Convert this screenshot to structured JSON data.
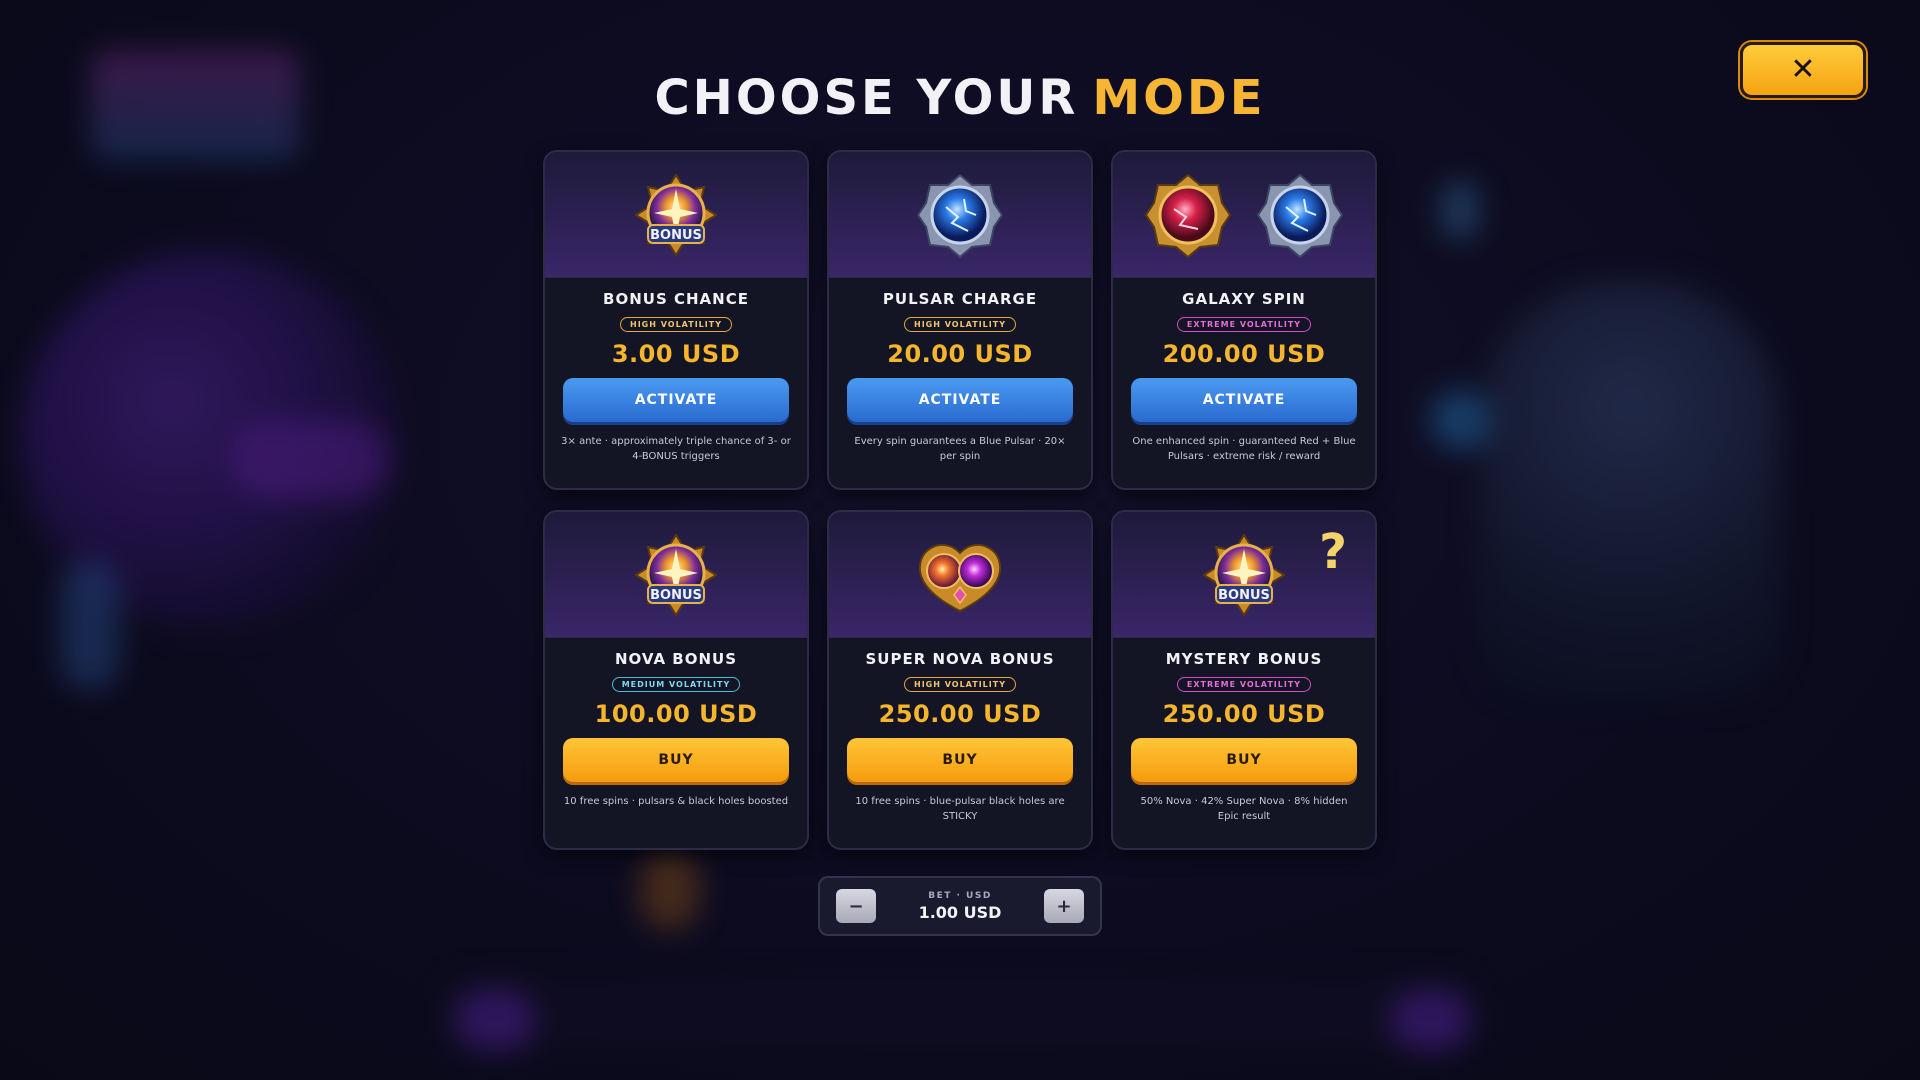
{
  "header": {
    "title_part1": "CHOOSE YOUR",
    "title_part2": "MODE",
    "close_label": "✕"
  },
  "colors": {
    "accent_gold": "#f6b533",
    "activate_blue": "#3a82e6",
    "buy_gold": "#f8b021",
    "high_volatility": "#e8a83a",
    "medium_volatility": "#4ab8d8",
    "extreme_volatility": "#d84ac8"
  },
  "cards": [
    {
      "name": "BONUS CHANCE",
      "volatility": "HIGH VOLATILITY",
      "volatility_level": "high",
      "price": "3.00 USD",
      "action": "ACTIVATE",
      "description": "3× ante · approximately triple chance of 3- or 4-BONUS triggers",
      "icon": "bonus-emblem-icon"
    },
    {
      "name": "PULSAR CHARGE",
      "volatility": "HIGH VOLATILITY",
      "volatility_level": "high",
      "price": "20.00 USD",
      "action": "ACTIVATE",
      "description": "Every spin guarantees a Blue Pulsar · 20× per spin",
      "icon": "blue-pulsar-icon"
    },
    {
      "name": "GALAXY SPIN",
      "volatility": "EXTREME VOLATILITY",
      "volatility_level": "extreme",
      "price": "200.00 USD",
      "action": "ACTIVATE",
      "description": "One enhanced spin · guaranteed Red + Blue Pulsars · extreme risk / reward",
      "icon": "red-and-blue-pulsar-icon"
    },
    {
      "name": "NOVA BONUS",
      "volatility": "MEDIUM VOLATILITY",
      "volatility_level": "medium",
      "price": "100.00 USD",
      "action": "BUY",
      "description": "10 free spins · pulsars & black holes boosted",
      "icon": "bonus-emblem-icon"
    },
    {
      "name": "SUPER NOVA BONUS",
      "volatility": "HIGH VOLATILITY",
      "volatility_level": "high",
      "price": "250.00 USD",
      "action": "BUY",
      "description": "10 free spins · blue-pulsar black holes are STICKY",
      "icon": "super-nova-orb-icon"
    },
    {
      "name": "MYSTERY BONUS",
      "volatility": "EXTREME VOLATILITY",
      "volatility_level": "extreme",
      "price": "250.00 USD",
      "action": "BUY",
      "description": "50% Nova · 42% Super Nova · 8% hidden Epic result",
      "icon": "bonus-emblem-question-icon",
      "question_mark": "?"
    }
  ],
  "bet": {
    "label": "BET · USD",
    "value": "1.00 USD",
    "decrease_label": "−",
    "increase_label": "+"
  }
}
